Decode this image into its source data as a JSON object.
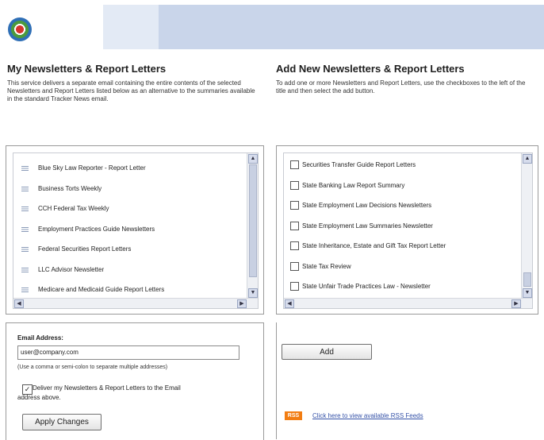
{
  "header": {
    "logo_icon": "globe-logo-icon"
  },
  "my_section": {
    "title": "My Newsletters & Report Letters",
    "description": "This service delivers a separate email containing the entire contents of the selected Newsletters and Report Letters listed below as an alternative to the summaries available in the standard Tracker News email.",
    "items": [
      "Blue Sky Law Reporter - Report Letter",
      "Business Torts Weekly",
      "CCH Federal Tax Weekly",
      "Employment Practices Guide Newsletters",
      "Federal Securities Report Letters",
      "LLC Advisor Newsletter",
      "Medicare and Medicaid Guide Report Letters"
    ]
  },
  "add_section": {
    "title": "Add New Newsletters & Report Letters",
    "description": "To add one or more Newsletters and Report Letters, use the checkboxes to the left of the title and then select the add button.",
    "items": [
      "Securities Transfer Guide Report Letters",
      "State Banking Law Report Summary",
      "State Employment Law Decisions Newsletters",
      "State Employment Law Summaries Newsletter",
      "State Inheritance, Estate and Gift Tax Report Letter",
      "State Tax Review",
      "State Unfair Trade Practices Law - Newsletter"
    ],
    "add_button": "Add"
  },
  "email": {
    "label": "Email Address:",
    "value": "user@company.com",
    "hint": "(Use a comma or semi-colon to separate multiple addresses)",
    "deliver_line1": "Deliver my Newsletters & Report Letters to the Email",
    "deliver_line2": "address above.",
    "deliver_checked": true,
    "apply_button": "Apply Changes"
  },
  "rss": {
    "badge": "RSS",
    "link": "Click here to view available RSS Feeds"
  },
  "colors": {
    "banner_light": "#e3eaf5",
    "banner_dark": "#c9d5ea",
    "rss_orange": "#f27d12",
    "link_blue": "#3552a8"
  }
}
